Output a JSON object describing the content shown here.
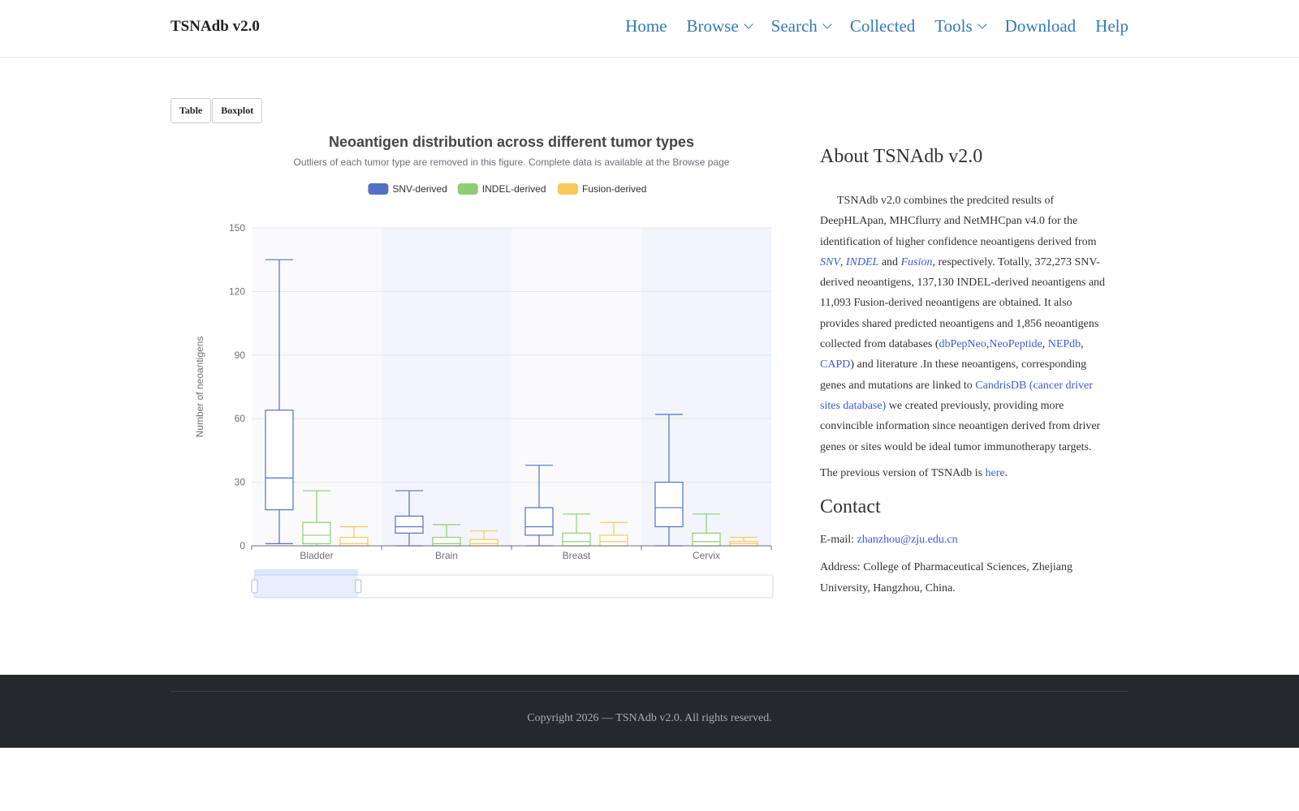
{
  "brand": "TSNAdb v2.0",
  "nav": [
    {
      "label": "Home",
      "dropdown": false
    },
    {
      "label": "Browse",
      "dropdown": true
    },
    {
      "label": "Search",
      "dropdown": true
    },
    {
      "label": "Collected",
      "dropdown": false
    },
    {
      "label": "Tools",
      "dropdown": true
    },
    {
      "label": "Download",
      "dropdown": false
    },
    {
      "label": "Help",
      "dropdown": false
    }
  ],
  "buttons": {
    "table": "Table",
    "boxplot": "Boxplot"
  },
  "chart_data": {
    "type": "boxplot",
    "title": "Neoantigen distribution across different tumor types",
    "subtitle": "Outliers of each tumor type are removed in this figure. Complete data is available at the Browse page",
    "ylabel": "Number of neoantigens",
    "xlabel": "",
    "ylim": [
      0,
      150
    ],
    "yticks": [
      0,
      30,
      60,
      90,
      120,
      150
    ],
    "legend_position": "top-center",
    "categories": [
      "Bladder",
      "Brain",
      "Breast",
      "Cervix"
    ],
    "series": [
      {
        "name": "SNV-derived",
        "color": "#5470c6",
        "boxes": [
          [
            1,
            17,
            32,
            64,
            135
          ],
          [
            0,
            6,
            9,
            14,
            26
          ],
          [
            0,
            5,
            9,
            18,
            38
          ],
          [
            0,
            9,
            18,
            30,
            62
          ]
        ]
      },
      {
        "name": "INDEL-derived",
        "color": "#91cc75",
        "boxes": [
          [
            0,
            1,
            5,
            11,
            26
          ],
          [
            0,
            0,
            1,
            4,
            10
          ],
          [
            0,
            0,
            2,
            6,
            15
          ],
          [
            0,
            0,
            2,
            6,
            15
          ]
        ]
      },
      {
        "name": "Fusion-derived",
        "color": "#fac858",
        "boxes": [
          [
            0,
            0,
            1,
            4,
            9
          ],
          [
            0,
            0,
            1,
            3,
            7
          ],
          [
            0,
            0,
            2,
            5,
            11
          ],
          [
            0,
            0,
            1,
            2,
            4
          ]
        ]
      }
    ],
    "zoom_window": [
      0,
      0.2
    ]
  },
  "about": {
    "title": "About TSNAdb v2.0",
    "p1_a": "TSNAdb v2.0 combines the predcited results of DeepHLApan, MHCflurry and NetMHCpan v4.0 for the identification of higher confidence neoantigens derived from ",
    "snv": "SNV",
    "sep1": ", ",
    "indel": "INDEL",
    "and": " and ",
    "fusion": "Fusion",
    "p1_b": ", respectively. Totally, 372,273 SNV-derived neoantigens, 137,130 INDEL-derived neoantigens and 11,093 Fusion-derived neoantigens are obtained. It also provides shared predicted neoantigens and 1,856 neoantigens collected from databases (",
    "db1": "dbPepNeo",
    "comma1": ",",
    "db2": "NeoPeptide",
    "comma2": ", ",
    "db3": "NEPdb",
    "comma3": ", ",
    "db4": "CAPD",
    "p1_c": ") and literature .In these neoantigens, corresponding genes and mutations are linked to ",
    "candris": "CandrisDB (cancer driver sites database)",
    "p1_d": " we created previously, providing more convincible information since neoantigen derived from driver genes or sites would be ideal tumor immunotherapy targets.",
    "prev_a": "The previous version of TSNAdb is ",
    "prev_link": "here",
    "prev_b": "."
  },
  "contact": {
    "title": "Contact",
    "email_label": "E-mail: ",
    "email": "zhanzhou@zju.edu.cn",
    "address": "Address: College of Pharmaceutical Sciences, Zhejiang University, Hangzhou, China."
  },
  "footer": "Copyright 2026 — TSNAdb v2.0. All rights reserved."
}
